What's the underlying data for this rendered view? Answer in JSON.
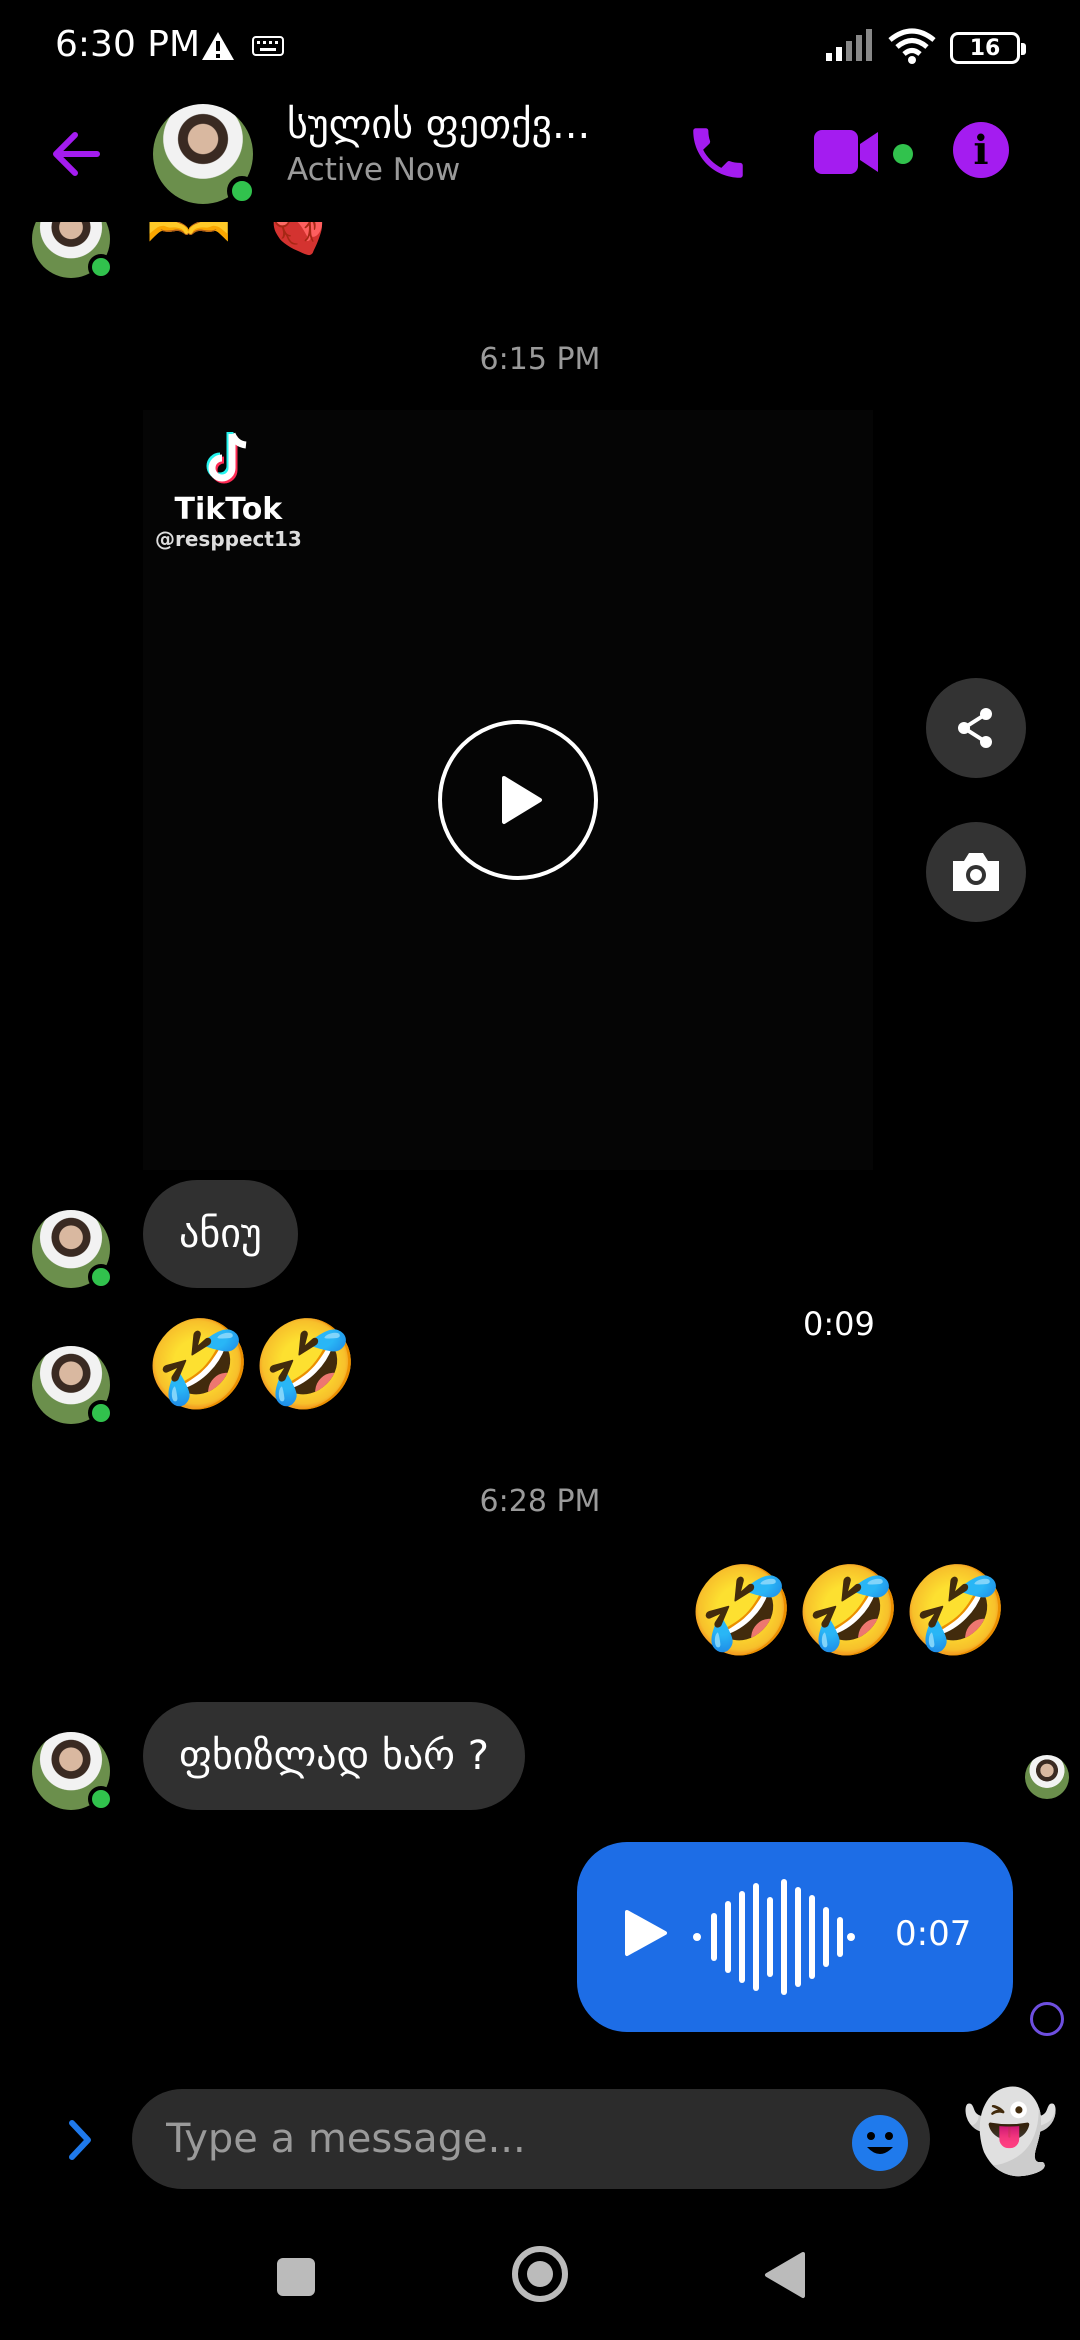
{
  "status_bar": {
    "time": "6:30 PM",
    "battery": "16"
  },
  "header": {
    "contact_name": "სულის ფეთქვ...",
    "contact_status": "Active Now",
    "accent_color": "#a41cf0"
  },
  "chat": {
    "top_emojis": "🫶 🫀",
    "timestamp_1": "6:15 PM",
    "shared_video": {
      "source_name": "TikTok",
      "source_handle": "@resppect13",
      "duration": "0:09"
    },
    "msg_text_1": "ანიუ",
    "msg_emoji_1": "🤣🤣",
    "timestamp_2": "6:28 PM",
    "sent_emoji": "🤣🤣🤣",
    "msg_text_2": "ფხიზლად ხარ ?",
    "voice_message": {
      "duration": "0:07",
      "color": "#1d6de6"
    }
  },
  "composer": {
    "placeholder": "Type a message...",
    "ghost_emoji": "👻"
  },
  "icons": {
    "back": "arrow-left-icon",
    "call": "phone-icon",
    "video": "video-camera-icon",
    "info": "info-icon",
    "share": "share-icon",
    "camera": "camera-icon",
    "play": "play-icon",
    "emoji": "smiley-icon",
    "expand": "chevron-right-icon"
  }
}
